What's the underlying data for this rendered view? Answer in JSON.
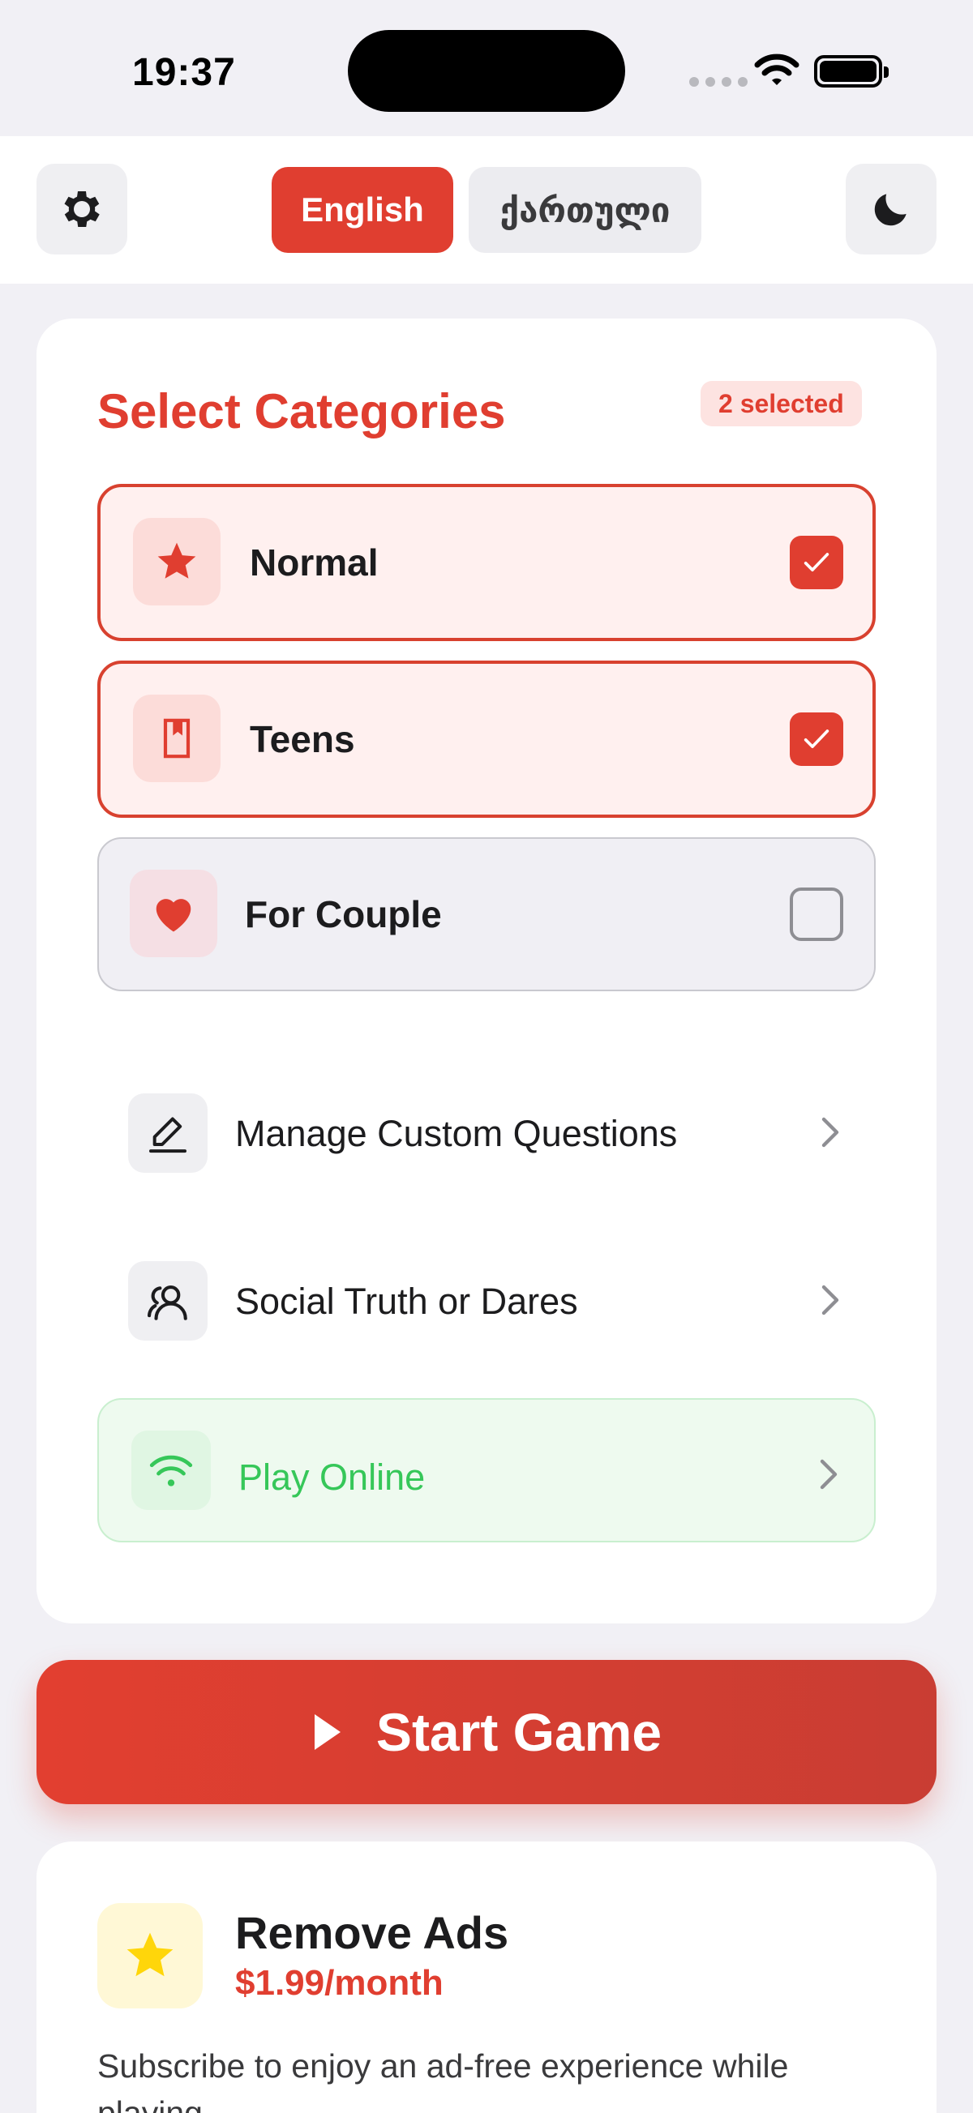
{
  "status_bar": {
    "time": "19:37"
  },
  "header": {
    "languages": [
      {
        "label": "English",
        "active": true
      },
      {
        "label": "ქართული",
        "active": false
      }
    ]
  },
  "categories": {
    "title": "Select Categories",
    "selected_count": "2 selected",
    "items": [
      {
        "label": "Normal",
        "icon": "star-icon",
        "selected": true
      },
      {
        "label": "Teens",
        "icon": "bookmark-icon",
        "selected": true
      },
      {
        "label": "For Couple",
        "icon": "heart-icon",
        "selected": false
      }
    ],
    "links": [
      {
        "label": "Manage Custom Questions",
        "icon": "pencil-icon"
      },
      {
        "label": "Social Truth or Dares",
        "icon": "people-icon"
      },
      {
        "label": "Play Online",
        "icon": "wifi-icon"
      }
    ]
  },
  "start_button": {
    "label": "Start Game"
  },
  "remove_ads": {
    "title": "Remove Ads",
    "price": "$1.99/month",
    "description": "Subscribe to enjoy an ad-free experience while playing."
  },
  "colors": {
    "accent": "#e03e30",
    "online_green": "#36c759",
    "ads_star": "#ffd60a"
  }
}
